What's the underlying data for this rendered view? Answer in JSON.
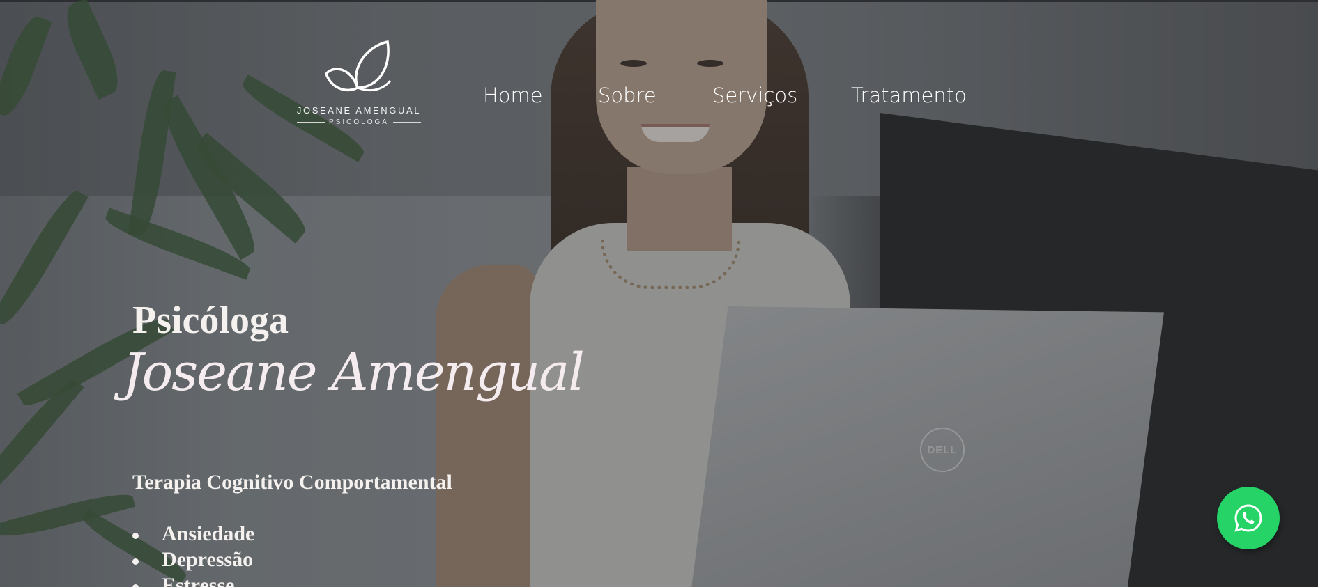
{
  "brand": {
    "name": "JOSEANE AMENGUAL",
    "tagline": "PSICÓLOGA",
    "logo_icon": "leaf-logo-icon"
  },
  "nav": {
    "items": [
      {
        "label": "Home"
      },
      {
        "label": "Sobre"
      },
      {
        "label": "Serviços"
      },
      {
        "label": "Tratamento"
      }
    ]
  },
  "hero": {
    "title": "Psicóloga",
    "name": "Joseane Amengual",
    "subtitle": "Terapia Cognitivo Comportamental",
    "topics": [
      "Ansiedade",
      "Depressão",
      "Estresse"
    ]
  },
  "laptop_brand": "DELL",
  "whatsapp": {
    "icon": "whatsapp-icon",
    "color": "#25d366"
  }
}
